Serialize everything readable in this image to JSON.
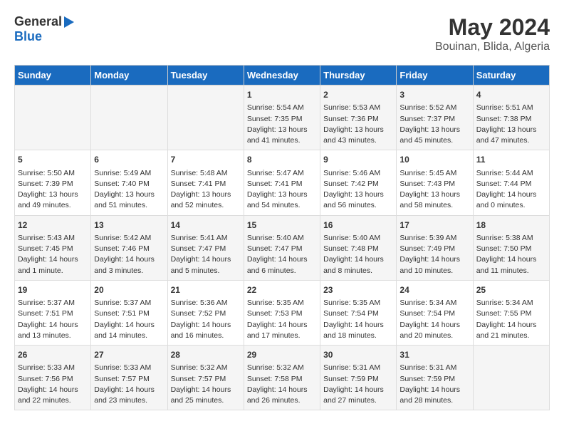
{
  "header": {
    "logo_general": "General",
    "logo_blue": "Blue",
    "month_year": "May 2024",
    "location": "Bouinan, Blida, Algeria"
  },
  "days_of_week": [
    "Sunday",
    "Monday",
    "Tuesday",
    "Wednesday",
    "Thursday",
    "Friday",
    "Saturday"
  ],
  "weeks": [
    [
      {
        "day": "",
        "content": ""
      },
      {
        "day": "",
        "content": ""
      },
      {
        "day": "",
        "content": ""
      },
      {
        "day": "1",
        "content": "Sunrise: 5:54 AM\nSunset: 7:35 PM\nDaylight: 13 hours and 41 minutes."
      },
      {
        "day": "2",
        "content": "Sunrise: 5:53 AM\nSunset: 7:36 PM\nDaylight: 13 hours and 43 minutes."
      },
      {
        "day": "3",
        "content": "Sunrise: 5:52 AM\nSunset: 7:37 PM\nDaylight: 13 hours and 45 minutes."
      },
      {
        "day": "4",
        "content": "Sunrise: 5:51 AM\nSunset: 7:38 PM\nDaylight: 13 hours and 47 minutes."
      }
    ],
    [
      {
        "day": "5",
        "content": "Sunrise: 5:50 AM\nSunset: 7:39 PM\nDaylight: 13 hours and 49 minutes."
      },
      {
        "day": "6",
        "content": "Sunrise: 5:49 AM\nSunset: 7:40 PM\nDaylight: 13 hours and 51 minutes."
      },
      {
        "day": "7",
        "content": "Sunrise: 5:48 AM\nSunset: 7:41 PM\nDaylight: 13 hours and 52 minutes."
      },
      {
        "day": "8",
        "content": "Sunrise: 5:47 AM\nSunset: 7:41 PM\nDaylight: 13 hours and 54 minutes."
      },
      {
        "day": "9",
        "content": "Sunrise: 5:46 AM\nSunset: 7:42 PM\nDaylight: 13 hours and 56 minutes."
      },
      {
        "day": "10",
        "content": "Sunrise: 5:45 AM\nSunset: 7:43 PM\nDaylight: 13 hours and 58 minutes."
      },
      {
        "day": "11",
        "content": "Sunrise: 5:44 AM\nSunset: 7:44 PM\nDaylight: 14 hours and 0 minutes."
      }
    ],
    [
      {
        "day": "12",
        "content": "Sunrise: 5:43 AM\nSunset: 7:45 PM\nDaylight: 14 hours and 1 minute."
      },
      {
        "day": "13",
        "content": "Sunrise: 5:42 AM\nSunset: 7:46 PM\nDaylight: 14 hours and 3 minutes."
      },
      {
        "day": "14",
        "content": "Sunrise: 5:41 AM\nSunset: 7:47 PM\nDaylight: 14 hours and 5 minutes."
      },
      {
        "day": "15",
        "content": "Sunrise: 5:40 AM\nSunset: 7:47 PM\nDaylight: 14 hours and 6 minutes."
      },
      {
        "day": "16",
        "content": "Sunrise: 5:40 AM\nSunset: 7:48 PM\nDaylight: 14 hours and 8 minutes."
      },
      {
        "day": "17",
        "content": "Sunrise: 5:39 AM\nSunset: 7:49 PM\nDaylight: 14 hours and 10 minutes."
      },
      {
        "day": "18",
        "content": "Sunrise: 5:38 AM\nSunset: 7:50 PM\nDaylight: 14 hours and 11 minutes."
      }
    ],
    [
      {
        "day": "19",
        "content": "Sunrise: 5:37 AM\nSunset: 7:51 PM\nDaylight: 14 hours and 13 minutes."
      },
      {
        "day": "20",
        "content": "Sunrise: 5:37 AM\nSunset: 7:51 PM\nDaylight: 14 hours and 14 minutes."
      },
      {
        "day": "21",
        "content": "Sunrise: 5:36 AM\nSunset: 7:52 PM\nDaylight: 14 hours and 16 minutes."
      },
      {
        "day": "22",
        "content": "Sunrise: 5:35 AM\nSunset: 7:53 PM\nDaylight: 14 hours and 17 minutes."
      },
      {
        "day": "23",
        "content": "Sunrise: 5:35 AM\nSunset: 7:54 PM\nDaylight: 14 hours and 18 minutes."
      },
      {
        "day": "24",
        "content": "Sunrise: 5:34 AM\nSunset: 7:54 PM\nDaylight: 14 hours and 20 minutes."
      },
      {
        "day": "25",
        "content": "Sunrise: 5:34 AM\nSunset: 7:55 PM\nDaylight: 14 hours and 21 minutes."
      }
    ],
    [
      {
        "day": "26",
        "content": "Sunrise: 5:33 AM\nSunset: 7:56 PM\nDaylight: 14 hours and 22 minutes."
      },
      {
        "day": "27",
        "content": "Sunrise: 5:33 AM\nSunset: 7:57 PM\nDaylight: 14 hours and 23 minutes."
      },
      {
        "day": "28",
        "content": "Sunrise: 5:32 AM\nSunset: 7:57 PM\nDaylight: 14 hours and 25 minutes."
      },
      {
        "day": "29",
        "content": "Sunrise: 5:32 AM\nSunset: 7:58 PM\nDaylight: 14 hours and 26 minutes."
      },
      {
        "day": "30",
        "content": "Sunrise: 5:31 AM\nSunset: 7:59 PM\nDaylight: 14 hours and 27 minutes."
      },
      {
        "day": "31",
        "content": "Sunrise: 5:31 AM\nSunset: 7:59 PM\nDaylight: 14 hours and 28 minutes."
      },
      {
        "day": "",
        "content": ""
      }
    ]
  ]
}
